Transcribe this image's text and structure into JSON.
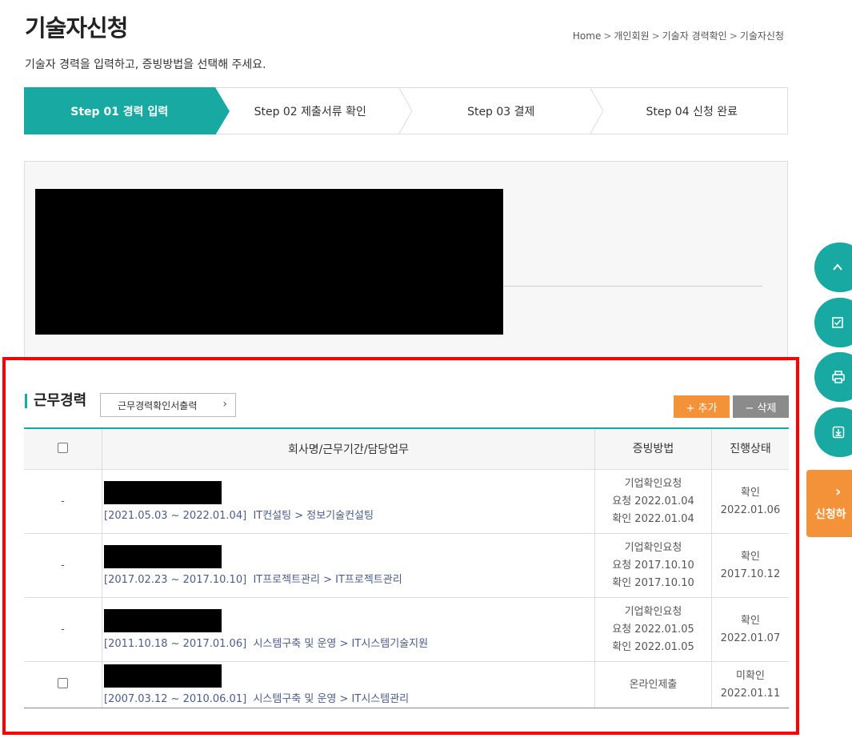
{
  "page": {
    "title": "기술자신청",
    "subtitle": "기술자 경력을 입력하고, 증빙방법을 선택해 주세요.",
    "breadcrumb": [
      "Home",
      "개인회원",
      "기술자 경력확인",
      "기술자신청"
    ]
  },
  "steps": [
    {
      "label": "Step 01 경력 입력",
      "active": true
    },
    {
      "label": "Step 02 제출서류 확인",
      "active": false
    },
    {
      "label": "Step 03 결제",
      "active": false
    },
    {
      "label": "Step 04 신청 완료",
      "active": false
    }
  ],
  "career": {
    "section_title": "근무경력",
    "print_button": "근무경력확인서출력",
    "add_button": "+ 추가",
    "delete_button": "− 삭제",
    "headers": {
      "company": "회사명/근무기간/담당업무",
      "proof": "증빙방법",
      "status": "진행상태"
    },
    "rows": [
      {
        "marker": "-",
        "period": "[2021.05.03 ~ 2022.01.04]",
        "duty": "IT컨설팅 > 정보기술컨설팅",
        "proof": [
          "기업확인요청",
          "요청 2022.01.04",
          "확인 2022.01.04"
        ],
        "status": [
          "확인",
          "2022.01.06"
        ]
      },
      {
        "marker": "-",
        "period": "[2017.02.23 ~ 2017.10.10]",
        "duty": "IT프로젝트관리 > IT프로젝트관리",
        "proof": [
          "기업확인요청",
          "요청 2017.10.10",
          "확인 2017.10.10"
        ],
        "status": [
          "확인",
          "2017.10.12"
        ]
      },
      {
        "marker": "-",
        "period": "[2011.10.18 ~ 2017.01.06]",
        "duty": "시스템구축 및 운영 > IT시스템기술지원",
        "proof": [
          "기업확인요청",
          "요청 2022.01.05",
          "확인 2022.01.05"
        ],
        "status": [
          "확인",
          "2022.01.07"
        ]
      },
      {
        "marker": "checkbox",
        "period": "[2007.03.12 ~ 2010.06.01]",
        "duty": "시스템구축 및 운영 > IT시스템관리",
        "proof": [
          "온라인제출"
        ],
        "status": [
          "미확인",
          "2022.01.11"
        ]
      }
    ]
  },
  "side_menu": {
    "apply_label": "신청하",
    "icons": [
      "chevron-up-icon",
      "checkbox-icon",
      "printer-icon",
      "download-icon"
    ]
  },
  "colors": {
    "accent": "#17a9a2",
    "orange": "#f39239",
    "gray_button": "#8b8b8b",
    "highlight": "#ff0000"
  }
}
